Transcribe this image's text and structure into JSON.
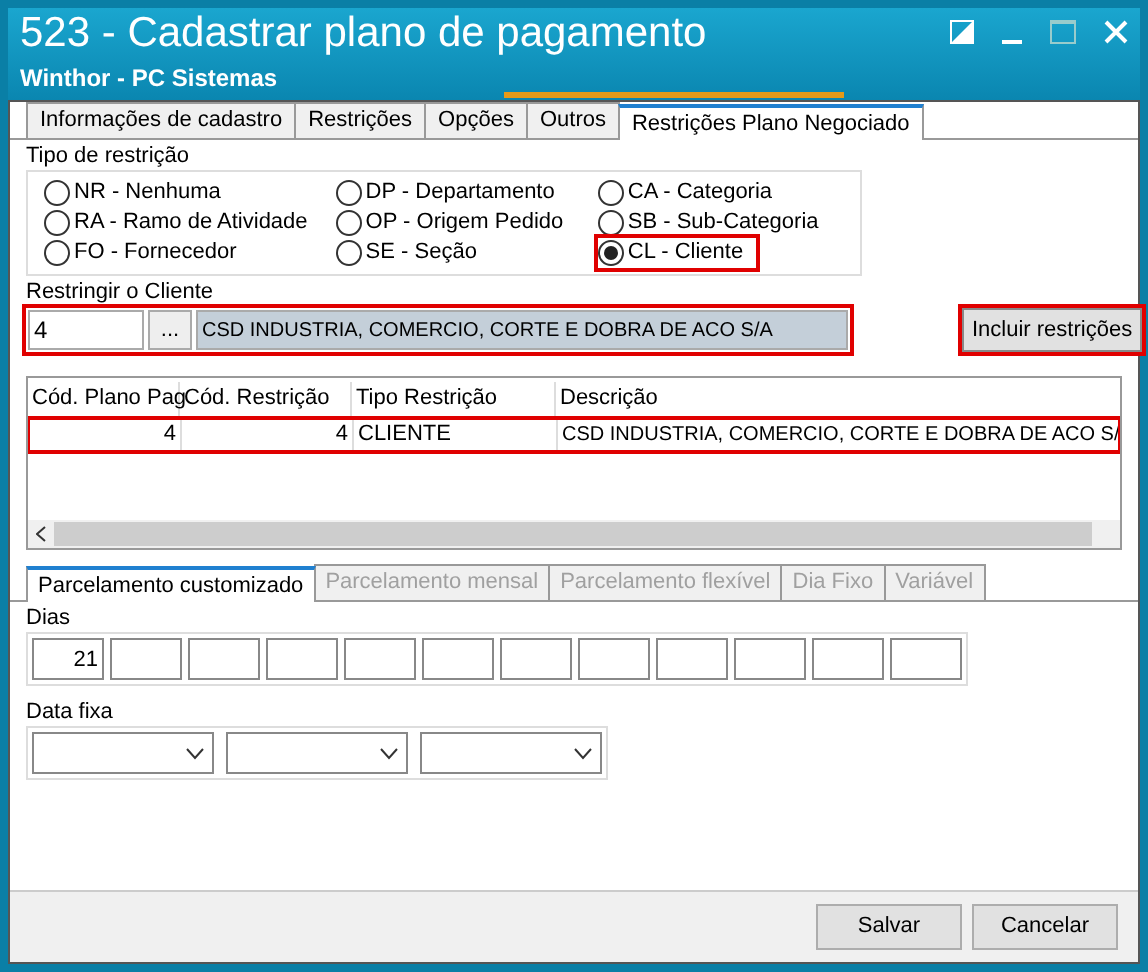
{
  "window": {
    "title": "523 - Cadastrar plano de pagamento",
    "subtitle": "Winthor - PC Sistemas"
  },
  "tabs": [
    {
      "label": "Informações de cadastro",
      "selected": false
    },
    {
      "label": "Restrições",
      "selected": false
    },
    {
      "label": "Opções",
      "selected": false
    },
    {
      "label": "Outros",
      "selected": false
    },
    {
      "label": "Restrições Plano Negociado",
      "selected": true
    }
  ],
  "restriction_type": {
    "title": "Tipo de restrição",
    "options": [
      {
        "label": "NR - Nenhuma",
        "selected": false,
        "highlighted": false
      },
      {
        "label": "RA - Ramo de Atividade",
        "selected": false,
        "highlighted": false
      },
      {
        "label": "FO - Fornecedor",
        "selected": false,
        "highlighted": false
      },
      {
        "label": "DP - Departamento",
        "selected": false,
        "highlighted": false
      },
      {
        "label": "OP - Origem Pedido",
        "selected": false,
        "highlighted": false
      },
      {
        "label": "SE - Seção",
        "selected": false,
        "highlighted": false
      },
      {
        "label": "CA - Categoria",
        "selected": false,
        "highlighted": false
      },
      {
        "label": "SB - Sub-Categoria",
        "selected": false,
        "highlighted": false
      },
      {
        "label": "CL - Cliente",
        "selected": true,
        "highlighted": true
      }
    ]
  },
  "client": {
    "label": "Restringir o Cliente",
    "code": "4",
    "lookup": "...",
    "name": "CSD INDUSTRIA, COMERCIO, CORTE E DOBRA DE ACO S/A",
    "highlighted": true
  },
  "include_button": {
    "label": "Incluir restrições",
    "highlighted": true
  },
  "table": {
    "columns": [
      "Cód. Plano Pag",
      "Cód. Restrição",
      "Tipo Restrição",
      "Descrição"
    ],
    "rows": [
      {
        "cells": [
          "4",
          "4",
          "CLIENTE",
          "CSD INDUSTRIA, COMERCIO, CORTE E DOBRA DE ACO S/"
        ],
        "highlighted": true
      }
    ]
  },
  "sub_tabs": [
    {
      "label": "Parcelamento customizado",
      "selected": true,
      "disabled": false
    },
    {
      "label": "Parcelamento mensal",
      "selected": false,
      "disabled": true
    },
    {
      "label": "Parcelamento flexível",
      "selected": false,
      "disabled": true
    },
    {
      "label": "Dia Fixo",
      "selected": false,
      "disabled": true
    },
    {
      "label": "Variável",
      "selected": false,
      "disabled": true
    }
  ],
  "days": {
    "title": "Dias",
    "values": [
      "21"
    ]
  },
  "fixed_date": {
    "title": "Data fixa"
  },
  "buttons": [
    "Salvar",
    "Cancelar"
  ]
}
